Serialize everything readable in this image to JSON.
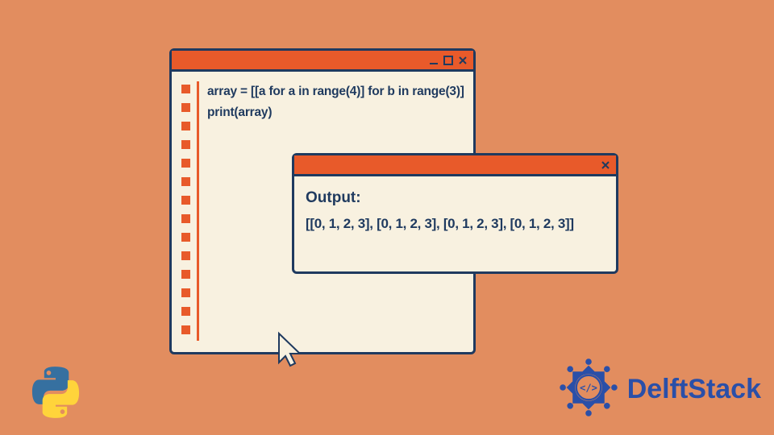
{
  "code": {
    "line1": "array = [[a for a in range(4)] for b in range(3)]",
    "line2": "print(array)"
  },
  "output": {
    "label": "Output:",
    "value": "[[0, 1, 2, 3], [0, 1, 2, 3], [0, 1, 2, 3], [0, 1, 2, 3]]"
  },
  "brand": {
    "name": "DelftStack"
  }
}
